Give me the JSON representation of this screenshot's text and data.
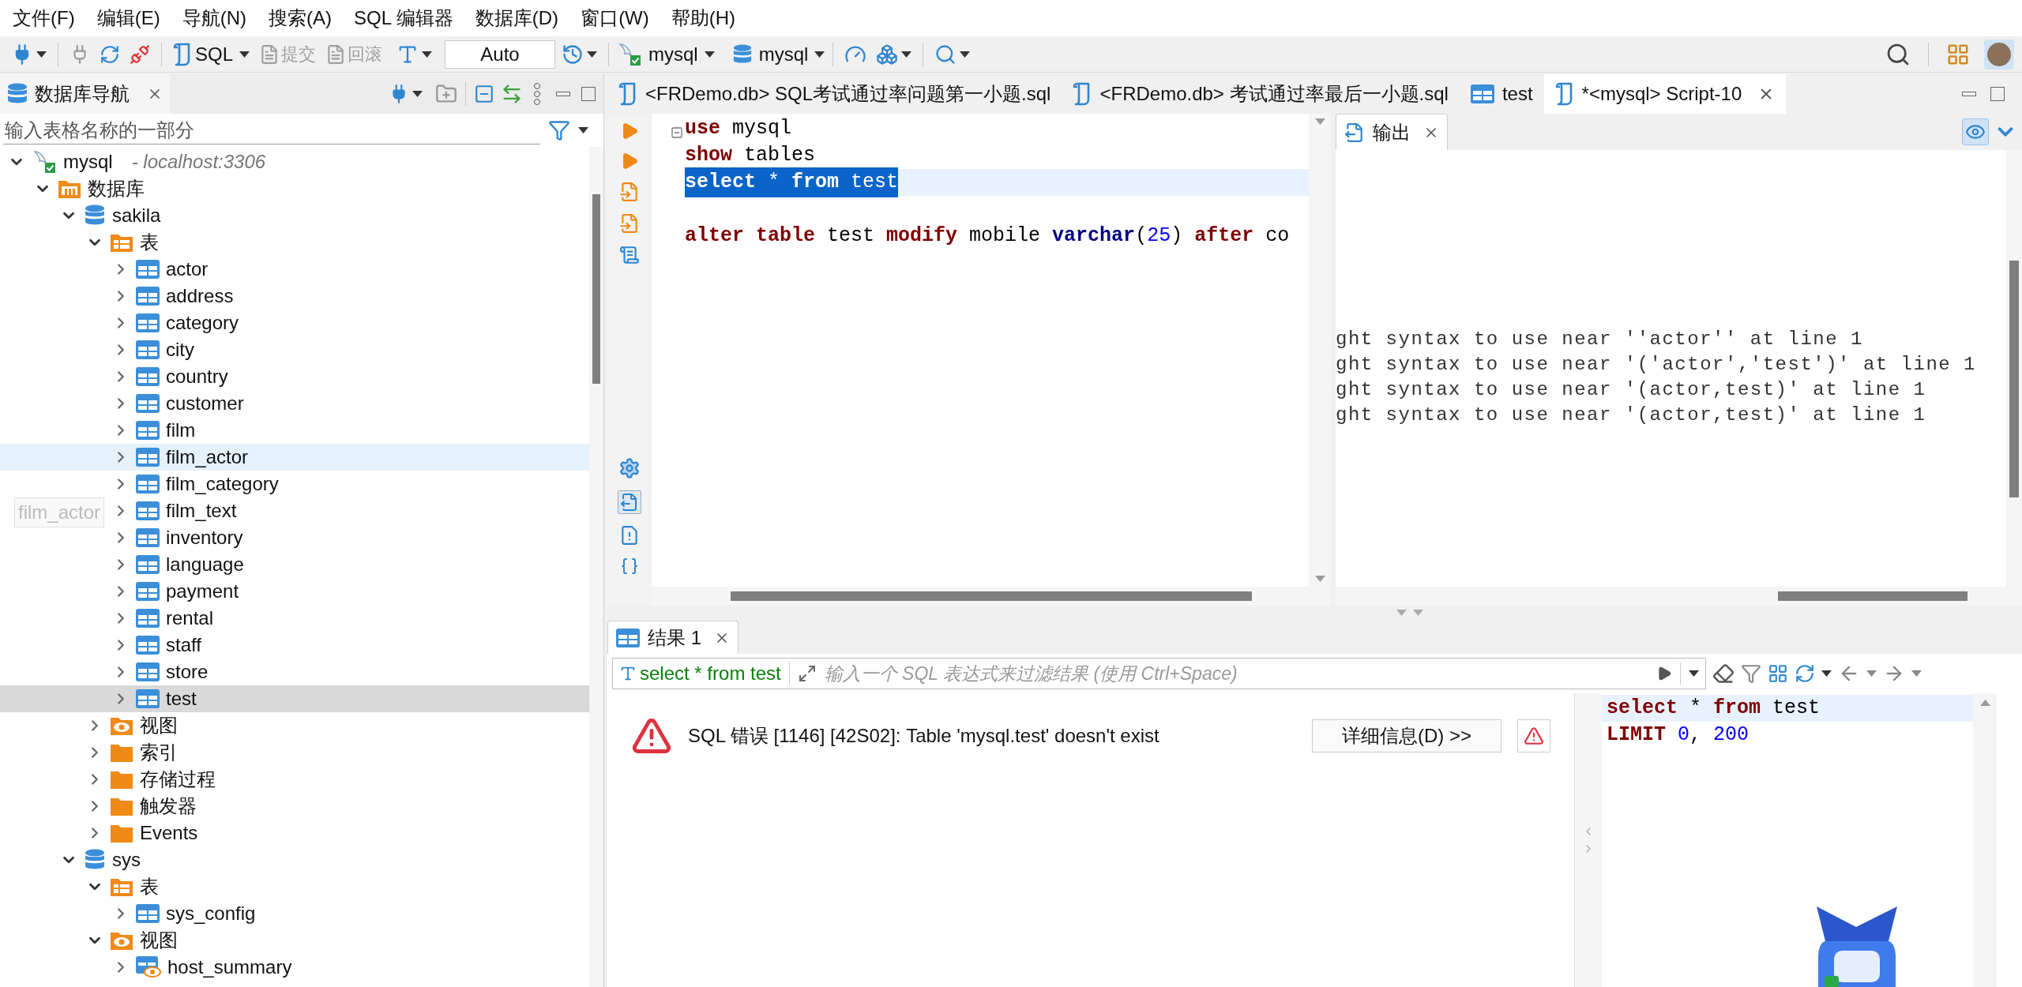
{
  "menu": [
    "文件(F)",
    "编辑(E)",
    "导航(N)",
    "搜索(A)",
    "SQL 编辑器",
    "数据库(D)",
    "窗口(W)",
    "帮助(H)"
  ],
  "toolbar": {
    "sql_label": "SQL",
    "commit": {
      "label": "提交",
      "disabled": true
    },
    "rollback": {
      "label": "回滚",
      "disabled": true
    },
    "transaction_mode": "Auto",
    "connection": "mysql",
    "database": "mysql"
  },
  "navigator": {
    "title": "数据库导航",
    "filter_placeholder": "输入表格名称的一部分",
    "drag_label": "film_actor",
    "tree": [
      {
        "label": "mysql",
        "host": "- localhost:3306",
        "kind": "connection",
        "expanded": true,
        "selected": false,
        "hovered": false,
        "children": [
          {
            "label": "数据库",
            "kind": "databases",
            "expanded": true,
            "selected": false,
            "hovered": false,
            "children": [
              {
                "label": "sakila",
                "kind": "database",
                "expanded": true,
                "selected": false,
                "hovered": false,
                "children": [
                  {
                    "label": "表",
                    "kind": "tables",
                    "expanded": true,
                    "selected": false,
                    "hovered": false,
                    "children": [
                      {
                        "label": "actor",
                        "kind": "table",
                        "expanded": false,
                        "selected": false,
                        "hovered": false
                      },
                      {
                        "label": "address",
                        "kind": "table",
                        "expanded": false,
                        "selected": false,
                        "hovered": false
                      },
                      {
                        "label": "category",
                        "kind": "table",
                        "expanded": false,
                        "selected": false,
                        "hovered": false
                      },
                      {
                        "label": "city",
                        "kind": "table",
                        "expanded": false,
                        "selected": false,
                        "hovered": false
                      },
                      {
                        "label": "country",
                        "kind": "table",
                        "expanded": false,
                        "selected": false,
                        "hovered": false
                      },
                      {
                        "label": "customer",
                        "kind": "table",
                        "expanded": false,
                        "selected": false,
                        "hovered": false
                      },
                      {
                        "label": "film",
                        "kind": "table",
                        "expanded": false,
                        "selected": false,
                        "hovered": false
                      },
                      {
                        "label": "film_actor",
                        "kind": "table",
                        "expanded": false,
                        "selected": false,
                        "hovered": true
                      },
                      {
                        "label": "film_category",
                        "kind": "table",
                        "expanded": false,
                        "selected": false,
                        "hovered": false
                      },
                      {
                        "label": "film_text",
                        "kind": "table",
                        "expanded": false,
                        "selected": false,
                        "hovered": false
                      },
                      {
                        "label": "inventory",
                        "kind": "table",
                        "expanded": false,
                        "selected": false,
                        "hovered": false
                      },
                      {
                        "label": "language",
                        "kind": "table",
                        "expanded": false,
                        "selected": false,
                        "hovered": false
                      },
                      {
                        "label": "payment",
                        "kind": "table",
                        "expanded": false,
                        "selected": false,
                        "hovered": false
                      },
                      {
                        "label": "rental",
                        "kind": "table",
                        "expanded": false,
                        "selected": false,
                        "hovered": false
                      },
                      {
                        "label": "staff",
                        "kind": "table",
                        "expanded": false,
                        "selected": false,
                        "hovered": false
                      },
                      {
                        "label": "store",
                        "kind": "table",
                        "expanded": false,
                        "selected": false,
                        "hovered": false
                      },
                      {
                        "label": "test",
                        "kind": "table",
                        "expanded": false,
                        "selected": true,
                        "hovered": false
                      }
                    ]
                  },
                  {
                    "label": "视图",
                    "kind": "views",
                    "expanded": false,
                    "selected": false,
                    "hovered": false
                  },
                  {
                    "label": "索引",
                    "kind": "folder",
                    "expanded": false,
                    "selected": false,
                    "hovered": false
                  },
                  {
                    "label": "存储过程",
                    "kind": "folder",
                    "expanded": false,
                    "selected": false,
                    "hovered": false
                  },
                  {
                    "label": "触发器",
                    "kind": "folder",
                    "expanded": false,
                    "selected": false,
                    "hovered": false
                  },
                  {
                    "label": "Events",
                    "kind": "folder",
                    "expanded": false,
                    "selected": false,
                    "hovered": false
                  }
                ]
              },
              {
                "label": "sys",
                "kind": "database",
                "expanded": true,
                "selected": false,
                "hovered": false,
                "children": [
                  {
                    "label": "表",
                    "kind": "tables",
                    "expanded": true,
                    "selected": false,
                    "hovered": false,
                    "children": [
                      {
                        "label": "sys_config",
                        "kind": "table",
                        "expanded": false,
                        "selected": false,
                        "hovered": false
                      }
                    ]
                  },
                  {
                    "label": "视图",
                    "kind": "views",
                    "expanded": true,
                    "selected": false,
                    "hovered": false,
                    "children": [
                      {
                        "label": "host_summary",
                        "kind": "view",
                        "expanded": false,
                        "selected": false,
                        "hovered": false
                      }
                    ]
                  }
                ]
              }
            ]
          }
        ]
      }
    ]
  },
  "editor": {
    "tabs": [
      {
        "label": "<FRDemo.db> SQL考试通过率问题第一小题.sql",
        "kind": "script",
        "selected": false
      },
      {
        "label": "<FRDemo.db> 考试通过率最后一小题.sql",
        "kind": "script",
        "selected": false
      },
      {
        "label": "test",
        "kind": "table",
        "selected": false
      },
      {
        "label": "*<mysql> Script-10",
        "kind": "script",
        "selected": true
      }
    ],
    "lines": [
      {
        "kind": "code",
        "current": false,
        "selected": false,
        "tokens": [
          {
            "kind": "keyword",
            "text": "use"
          },
          {
            "kind": "plain",
            "text": " mysql"
          }
        ]
      },
      {
        "kind": "code",
        "current": false,
        "selected": false,
        "tokens": [
          {
            "kind": "keyword",
            "text": "show"
          },
          {
            "kind": "plain",
            "text": " tables"
          }
        ]
      },
      {
        "kind": "code",
        "current": true,
        "selected": true,
        "tokens": [
          {
            "kind": "keyword",
            "text": "select"
          },
          {
            "kind": "plain",
            "text": " * "
          },
          {
            "kind": "keyword",
            "text": "from"
          },
          {
            "kind": "plain",
            "text": " test"
          }
        ]
      },
      {
        "kind": "blank"
      },
      {
        "kind": "code",
        "current": false,
        "selected": false,
        "tokens": [
          {
            "kind": "keyword",
            "text": "alter"
          },
          {
            "kind": "keyword",
            "text": " table"
          },
          {
            "kind": "plain",
            "text": " test "
          },
          {
            "kind": "keyword",
            "text": "modify"
          },
          {
            "kind": "plain",
            "text": " mobile "
          },
          {
            "kind": "type",
            "text": "varchar"
          },
          {
            "kind": "plain",
            "text": "("
          },
          {
            "kind": "number",
            "text": "25"
          },
          {
            "kind": "plain",
            "text": ") "
          },
          {
            "kind": "keyword",
            "text": "after"
          },
          {
            "kind": "plain",
            "text": " co"
          }
        ]
      }
    ],
    "output": {
      "title": "输出",
      "visible": true,
      "lines": [
        "ght syntax to use near ''actor'' at line 1",
        "ght syntax to use near '('actor','test')' at line 1",
        "ght syntax to use near '(actor,test)' at line 1",
        "ght syntax to use near '(actor,test)' at line 1"
      ]
    }
  },
  "results": {
    "tab": "结果 1",
    "query": "select * from test",
    "filter_placeholder": "输入一个 SQL 表达式来过滤结果 (使用 Ctrl+Space)",
    "error": "SQL 错误 [1146] [42S02]: Table 'mysql.test' doesn't exist",
    "details_button": "详细信息(D) >>",
    "sql_lines": [
      {
        "current": true,
        "tokens": [
          {
            "kind": "keyword",
            "text": "select"
          },
          {
            "kind": "plain",
            "text": " * "
          },
          {
            "kind": "keyword",
            "text": "from"
          },
          {
            "kind": "plain",
            "text": " test"
          }
        ]
      },
      {
        "current": false,
        "tokens": [
          {
            "kind": "keyword",
            "text": "LIMIT"
          },
          {
            "kind": "number",
            "text": " 0"
          },
          {
            "kind": "plain",
            "text": ", "
          },
          {
            "kind": "number",
            "text": "200"
          }
        ]
      }
    ]
  }
}
